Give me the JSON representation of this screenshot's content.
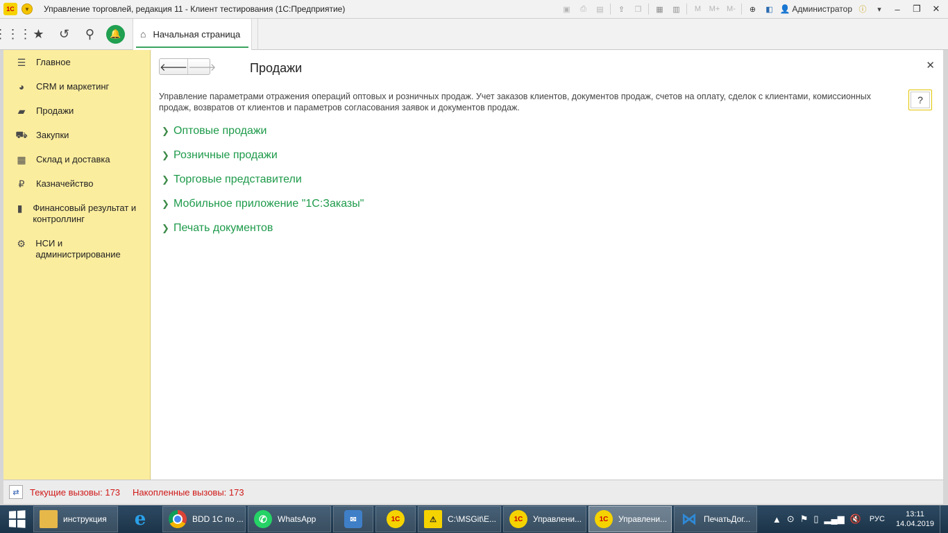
{
  "window": {
    "logo_text": "1С",
    "title": "Управление торговлей, редакция 11  - Клиент тестирования (1С:Предприятие)",
    "user": "Администратор",
    "m_buttons": [
      "M",
      "M+",
      "M-"
    ]
  },
  "toolbar2": {
    "home_tab": "Начальная страница"
  },
  "sidebar": {
    "items": [
      {
        "label": "Главное",
        "icon": "menu-icon"
      },
      {
        "label": "CRM и маркетинг",
        "icon": "pie-chart-icon"
      },
      {
        "label": "Продажи",
        "icon": "bag-icon"
      },
      {
        "label": "Закупки",
        "icon": "cart-icon"
      },
      {
        "label": "Склад и доставка",
        "icon": "warehouse-icon"
      },
      {
        "label": "Казначейство",
        "icon": "ruble-icon"
      },
      {
        "label": "Финансовый результат и контроллинг",
        "icon": "bar-chart-icon"
      },
      {
        "label": "НСИ и администрирование",
        "icon": "gear-icon"
      }
    ]
  },
  "main": {
    "title": "Продажи",
    "description": "Управление параметрами отражения операций оптовых и розничных продаж. Учет заказов клиентов, документов продаж, счетов на оплату, сделок с клиентами, комиссионных продаж, возвратов от клиентов и параметров согласования заявок и документов продаж.",
    "help_label": "?",
    "groups": [
      "Оптовые продажи",
      "Розничные продажи",
      "Торговые представители",
      "Мобильное приложение \"1С:Заказы\"",
      "Печать документов"
    ]
  },
  "status": {
    "current": "Текущие вызовы: 173",
    "accumulated": "Накопленные вызовы: 173"
  },
  "taskbar": {
    "items": [
      {
        "label": "инструкция",
        "icon": "folder-icon"
      },
      {
        "label": "",
        "icon": "ie-icon"
      },
      {
        "label": "BDD 1С по ...",
        "icon": "chrome-icon"
      },
      {
        "label": "WhatsApp",
        "icon": "whatsapp-icon"
      },
      {
        "label": "",
        "icon": "mail-icon"
      },
      {
        "label": "",
        "icon": "onec-icon"
      },
      {
        "label": "C:\\MSGit\\E...",
        "icon": "cmd-icon"
      },
      {
        "label": "Управлени...",
        "icon": "onec-icon"
      },
      {
        "label": "Управлени...",
        "icon": "onec-icon"
      },
      {
        "label": "ПечатьДог...",
        "icon": "vscode-icon"
      }
    ],
    "lang": "РУС",
    "time": "13:11",
    "date": "14.04.2019"
  }
}
